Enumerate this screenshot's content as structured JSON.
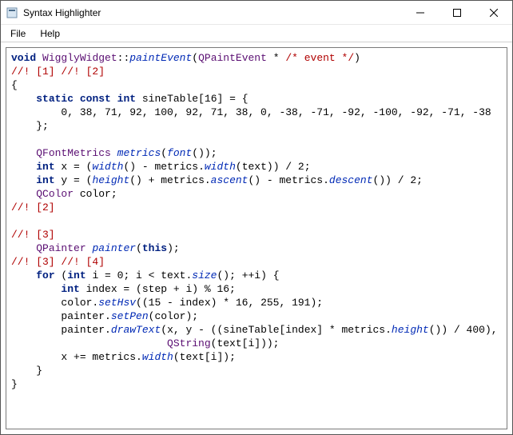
{
  "window": {
    "title": "Syntax Highlighter"
  },
  "menu": {
    "file": "File",
    "help": "Help"
  },
  "code": {
    "l01": {
      "kw_void": "void",
      "cls": "WigglyWidget",
      "sep": "::",
      "fn": "paintEvent",
      "open": "(",
      "arg_type": "QPaintEvent",
      "star": " * ",
      "cmt": "/* event */",
      "close": ")"
    },
    "l02": {
      "m1": "//! [1]",
      "sp": " ",
      "m2": "//! [2]"
    },
    "l03": "{",
    "l04": {
      "indent": "    ",
      "kw1": "static",
      "kw2": "const",
      "kw3": "int",
      "name": " sineTable[16] = {"
    },
    "l05": "        0, 38, 71, 92, 100, 92, 71, 38, 0, -38, -71, -92, -100, -92, -71, -38",
    "l06": "    };",
    "l07": "",
    "l08": {
      "indent": "    ",
      "typ": "QFontMetrics",
      "sp": " ",
      "var": "metrics",
      "open": "(",
      "fn": "font",
      "rest": "());"
    },
    "l09": {
      "indent": "    ",
      "kw": "int",
      "pre": " x = (",
      "fn1": "width",
      "mid": "() - metrics.",
      "fn2": "width",
      "post": "(text)) / 2;"
    },
    "l10": {
      "indent": "    ",
      "kw": "int",
      "pre": " y = (",
      "fn1": "height",
      "mid1": "() + metrics.",
      "fn2": "ascent",
      "mid2": "() - metrics.",
      "fn3": "descent",
      "post": "()) / 2;"
    },
    "l11": {
      "indent": "    ",
      "typ": "QColor",
      "rest": " color;"
    },
    "l12": {
      "m": "//! [2]"
    },
    "l13": "",
    "l14": {
      "m": "//! [3]"
    },
    "l15": {
      "indent": "    ",
      "typ": "QPainter",
      "sp": " ",
      "var": "painter",
      "open": "(",
      "kw": "this",
      "close": ");"
    },
    "l16": {
      "m1": "//! [3]",
      "sp": " ",
      "m2": "//! [4]"
    },
    "l17": {
      "indent": "    ",
      "kw_for": "for",
      "pre": " (",
      "kw_int": "int",
      "mid1": " i = 0; i < text.",
      "fn": "size",
      "post": "(); ++i) {"
    },
    "l18": {
      "indent": "        ",
      "kw": "int",
      "rest": " index = (step + i) % 16;"
    },
    "l19": {
      "indent": "        ",
      "pre": "color.",
      "fn": "setHsv",
      "post": "((15 - index) * 16, 255, 191);"
    },
    "l20": {
      "indent": "        ",
      "pre": "painter.",
      "fn": "setPen",
      "post": "(color);"
    },
    "l21": {
      "indent": "        ",
      "pre": "painter.",
      "fn1": "drawText",
      "mid": "(x, y - ((sineTable[index] * metrics.",
      "fn2": "height",
      "post": "()) / 400),"
    },
    "l22": {
      "indent": "                         ",
      "typ": "QString",
      "post": "(text[i]));"
    },
    "l23": {
      "indent": "        ",
      "pre": "x += metrics.",
      "fn": "width",
      "post": "(text[i]);"
    },
    "l24": "    }",
    "l25": "}"
  }
}
